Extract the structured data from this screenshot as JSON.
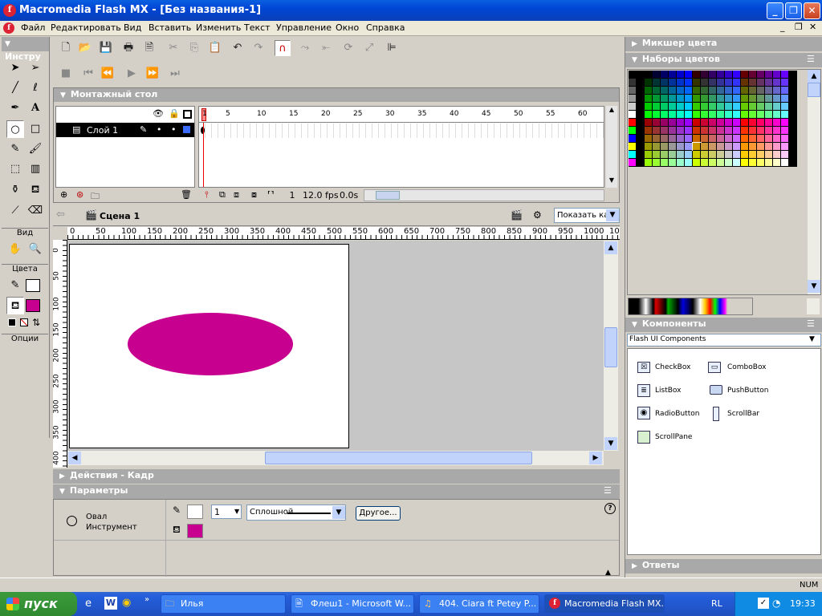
{
  "window": {
    "title": "Macromedia Flash MX - [Без названия-1]",
    "icon": "flash-icon"
  },
  "menu": [
    "Файл",
    "Редактировать",
    "Вид",
    "Вставить",
    "Изменить",
    "Текст",
    "Управление",
    "Окно",
    "Справка"
  ],
  "tools": {
    "header": "Инстру",
    "view_label": "Вид",
    "colors_label": "Цвета",
    "options_label": "Опции",
    "stroke_color": "#ffffff",
    "fill_color": "#c8008f"
  },
  "timeline": {
    "header": "Монтажный стол",
    "layer_name": "Слой 1",
    "ruler": [
      "1",
      "5",
      "10",
      "15",
      "20",
      "25",
      "30",
      "35",
      "40",
      "45",
      "50",
      "55",
      "60"
    ],
    "frame": "1",
    "fps": "12.0 fps",
    "time": "0.0s"
  },
  "scene": {
    "name": "Сцена 1",
    "zoom": "Показать ка"
  },
  "ruler_h": [
    "0",
    "50",
    "100",
    "150",
    "200",
    "250",
    "300",
    "350",
    "400",
    "450",
    "500",
    "550",
    "600",
    "650",
    "700",
    "750",
    "800",
    "850",
    "900",
    "950",
    "1000",
    "105"
  ],
  "ruler_v": [
    "0",
    "50",
    "100",
    "150",
    "200",
    "250",
    "300",
    "350",
    "400"
  ],
  "stage": {
    "shape_color": "#c8008f"
  },
  "panels": {
    "actions": "Действия - Кадр",
    "params": "Параметры",
    "tool_name": "Овал",
    "tool_type": "Инструмент",
    "stroke_width": "1",
    "stroke_style": "Сплошной",
    "other_button": "Другое...",
    "mixer": "Микшер цвета",
    "swatches": "Наборы цветов",
    "components": "Компоненты",
    "components_set": "Flash UI Components",
    "component_items": [
      "CheckBox",
      "ComboBox",
      "ListBox",
      "PushButton",
      "RadioButton",
      "ScrollBar",
      "ScrollPane"
    ],
    "answers": "Ответы"
  },
  "status": {
    "num": "NUM"
  },
  "taskbar": {
    "start": "пуск",
    "tasks": [
      "Илья",
      "Флеш1 - Microsoft W...",
      "404. Ciara ft Petey P...",
      "Macromedia Flash MX..."
    ],
    "lang": "RL",
    "clock": "19:33"
  }
}
